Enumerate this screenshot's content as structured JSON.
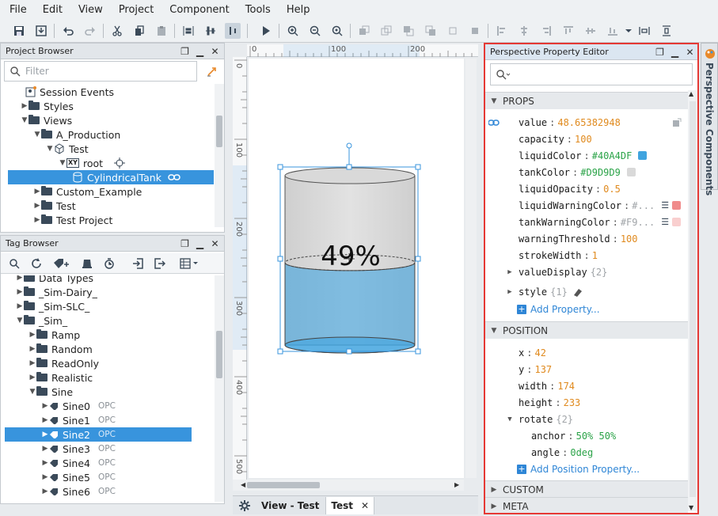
{
  "menu": [
    "File",
    "Edit",
    "View",
    "Project",
    "Component",
    "Tools",
    "Help"
  ],
  "project_browser": {
    "title": "Project Browser",
    "filter_placeholder": "Filter",
    "items": [
      {
        "label": "Session Events"
      },
      {
        "label": "Styles"
      },
      {
        "label": "Views"
      },
      {
        "label": "A_Production"
      },
      {
        "label": "Test"
      },
      {
        "label": "root"
      },
      {
        "label": "CylindricalTank"
      },
      {
        "label": "Custom_Example"
      },
      {
        "label": "Test"
      },
      {
        "label": "Test Project"
      }
    ]
  },
  "tag_browser": {
    "title": "Tag Browser",
    "items": [
      {
        "label": "Data Types"
      },
      {
        "label": "_Sim-Dairy_"
      },
      {
        "label": "_Sim-SLC_"
      },
      {
        "label": "_Sim_"
      },
      {
        "label": "Ramp"
      },
      {
        "label": "Random"
      },
      {
        "label": "ReadOnly"
      },
      {
        "label": "Realistic"
      },
      {
        "label": "Sine"
      },
      {
        "label": "Sine0",
        "badge": "OPC"
      },
      {
        "label": "Sine1",
        "badge": "OPC"
      },
      {
        "label": "Sine2",
        "badge": "OPC"
      },
      {
        "label": "Sine3",
        "badge": "OPC"
      },
      {
        "label": "Sine4",
        "badge": "OPC"
      },
      {
        "label": "Sine5",
        "badge": "OPC"
      },
      {
        "label": "Sine6",
        "badge": "OPC"
      }
    ]
  },
  "canvas": {
    "ruler_top": [
      "0",
      "100",
      "200"
    ],
    "ruler_left": [
      "0",
      "100",
      "200",
      "300",
      "400",
      "500"
    ],
    "tank_label": "49%",
    "tank_level": 0.4865382948,
    "tabs": {
      "label": "View - Test",
      "active": "Test"
    }
  },
  "property_editor": {
    "title": "Perspective Property Editor",
    "side_tab": "Perspective Components",
    "props_header": "PROPS",
    "props": [
      {
        "key": "value",
        "val": "48.65382948",
        "kind": "num"
      },
      {
        "key": "capacity",
        "val": "100",
        "kind": "num"
      },
      {
        "key": "liquidColor",
        "val": "#40A4DF",
        "kind": "str",
        "color": "#40A4DF"
      },
      {
        "key": "tankColor",
        "val": "#D9D9D9",
        "kind": "str",
        "color": "#D9D9D9"
      },
      {
        "key": "liquidOpacity",
        "val": "0.5",
        "kind": "num"
      },
      {
        "key": "liquidWarningColor",
        "val": "#...",
        "kind": "str",
        "color": "#F08C8C"
      },
      {
        "key": "tankWarningColor",
        "val": "#F9...",
        "kind": "str",
        "color": "#F9CFCF"
      },
      {
        "key": "warningThreshold",
        "val": "100",
        "kind": "num"
      },
      {
        "key": "strokeWidth",
        "val": "1",
        "kind": "num"
      }
    ],
    "value_display": {
      "key": "valueDisplay",
      "count": "{2}"
    },
    "style": {
      "key": "style",
      "count": "{1}"
    },
    "add_property": "Add Property...",
    "position_header": "POSITION",
    "position": [
      {
        "key": "x",
        "val": "42"
      },
      {
        "key": "y",
        "val": "137"
      },
      {
        "key": "width",
        "val": "174"
      },
      {
        "key": "height",
        "val": "233"
      }
    ],
    "rotate": {
      "key": "rotate",
      "count": "{2}"
    },
    "rotate_children": [
      {
        "key": "anchor",
        "val": "50% 50%"
      },
      {
        "key": "angle",
        "val": "0deg"
      }
    ],
    "add_position_property": "Add Position Property...",
    "custom_header": "CUSTOM",
    "meta_header": "META"
  },
  "colors": {
    "selection": "#3894dd",
    "liquid": "#40A4DF",
    "tank": "#D9D9D9",
    "highlight_border": "#e53935"
  }
}
